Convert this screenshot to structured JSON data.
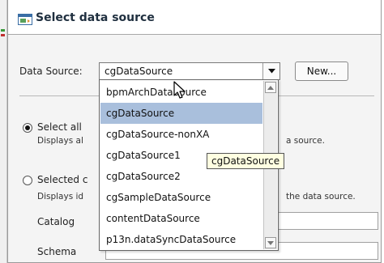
{
  "dialog": {
    "title": "Select data source"
  },
  "data_source": {
    "label": "Data Source:",
    "value": "cgDataSource",
    "new_button": "New...",
    "options": [
      "bpmArchDataSource",
      "cgDataSource",
      "cgDataSource-nonXA",
      "cgDataSource1",
      "cgDataSource2",
      "cgSampleDataSource",
      "contentDataSource",
      "p13n.dataSyncDataSource"
    ],
    "highlighted_index": 1
  },
  "tooltip": "cgDataSource",
  "select_all": {
    "label": "Select all",
    "desc_start": "Displays al",
    "desc_end": "a source.",
    "checked": true
  },
  "selected": {
    "label": "Selected c",
    "desc_start": "Displays id",
    "desc_end": "the data source.",
    "checked": false
  },
  "fields": {
    "catalog_label": "Catalog",
    "schema_label": "Schema"
  },
  "colors": {
    "highlight": "#a9bfdc",
    "tooltip_bg": "#ffffe1"
  },
  "icons": {
    "title": "window-icon",
    "dropdown": "chevron-down-icon",
    "scroll_up": "scroll-up-arrow-icon",
    "scroll_down": "scroll-down-arrow-icon",
    "cursor": "mouse-pointer-icon"
  }
}
